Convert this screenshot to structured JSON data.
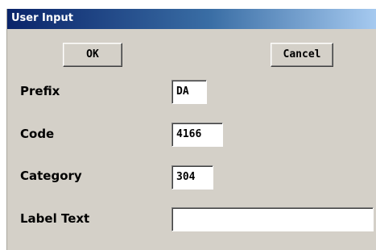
{
  "window": {
    "title": "User Input"
  },
  "buttons": {
    "ok_label": "OK",
    "cancel_label": "Cancel"
  },
  "fields": [
    {
      "label": "Prefix",
      "value": "DA"
    },
    {
      "label": "Code",
      "value": "4166"
    },
    {
      "label": "Category",
      "value": "304"
    },
    {
      "label": "Label Text",
      "value": ""
    }
  ],
  "colors": {
    "dialog_background": "#d4d0c8",
    "titlebar_start": "#0a246a",
    "titlebar_end": "#a6caf0",
    "title_text": "#ffffff",
    "field_background": "#ffffff"
  }
}
